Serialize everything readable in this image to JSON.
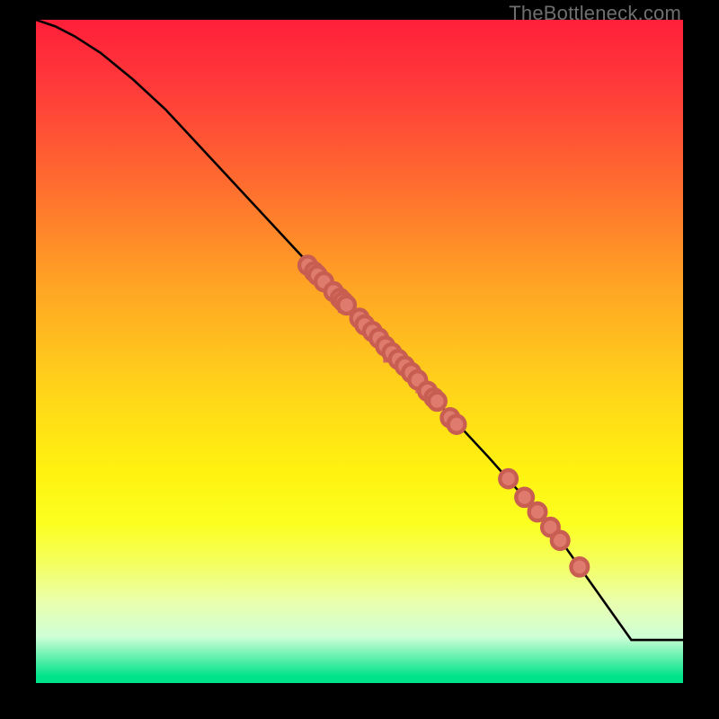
{
  "watermark": "TheBottleneck.com",
  "chart_data": {
    "type": "line",
    "title": "",
    "xlabel": "",
    "ylabel": "",
    "xlim": [
      0,
      100
    ],
    "ylim": [
      0,
      100
    ],
    "grid": false,
    "legend": false,
    "curve": {
      "x": [
        0,
        3,
        6,
        10,
        15,
        20,
        30,
        40,
        50,
        60,
        70,
        80,
        88,
        92,
        100
      ],
      "y": [
        100,
        99,
        97.5,
        95,
        91,
        86.5,
        76,
        65.5,
        55,
        44.5,
        34,
        23,
        12,
        6.5,
        6.5
      ]
    },
    "points_cluster_upper": [
      {
        "x": 42.0,
        "y": 63.0
      },
      {
        "x": 43.0,
        "y": 62.0
      },
      {
        "x": 43.5,
        "y": 61.5
      },
      {
        "x": 44.5,
        "y": 60.5
      },
      {
        "x": 46.0,
        "y": 59.0
      },
      {
        "x": 47.0,
        "y": 58.0
      },
      {
        "x": 47.5,
        "y": 57.5
      },
      {
        "x": 48.0,
        "y": 57.0
      },
      {
        "x": 50.0,
        "y": 55.0
      },
      {
        "x": 50.8,
        "y": 54.0
      },
      {
        "x": 52.0,
        "y": 53.0
      },
      {
        "x": 53.0,
        "y": 52.0
      },
      {
        "x": 54.0,
        "y": 50.8
      },
      {
        "x": 55.0,
        "y": 49.8
      },
      {
        "x": 56.0,
        "y": 48.8
      },
      {
        "x": 57.0,
        "y": 47.8
      },
      {
        "x": 58.0,
        "y": 46.8
      },
      {
        "x": 59.0,
        "y": 45.7
      },
      {
        "x": 60.5,
        "y": 44.0
      },
      {
        "x": 61.5,
        "y": 43.0
      },
      {
        "x": 62.0,
        "y": 42.5
      },
      {
        "x": 64.0,
        "y": 40.0
      },
      {
        "x": 65.0,
        "y": 39.0
      }
    ],
    "points_cluster_lower": [
      {
        "x": 73.0,
        "y": 30.8
      },
      {
        "x": 75.5,
        "y": 28.0
      },
      {
        "x": 77.5,
        "y": 25.8
      },
      {
        "x": 79.5,
        "y": 23.5
      },
      {
        "x": 81.0,
        "y": 21.5
      },
      {
        "x": 84.0,
        "y": 17.5
      }
    ],
    "point_radius": 1.3
  },
  "colors": {
    "dot_fill": "#de7a6e",
    "dot_stroke": "#c85e52",
    "curve": "#000000",
    "background": "#000000",
    "watermark": "#6f6f6f"
  }
}
